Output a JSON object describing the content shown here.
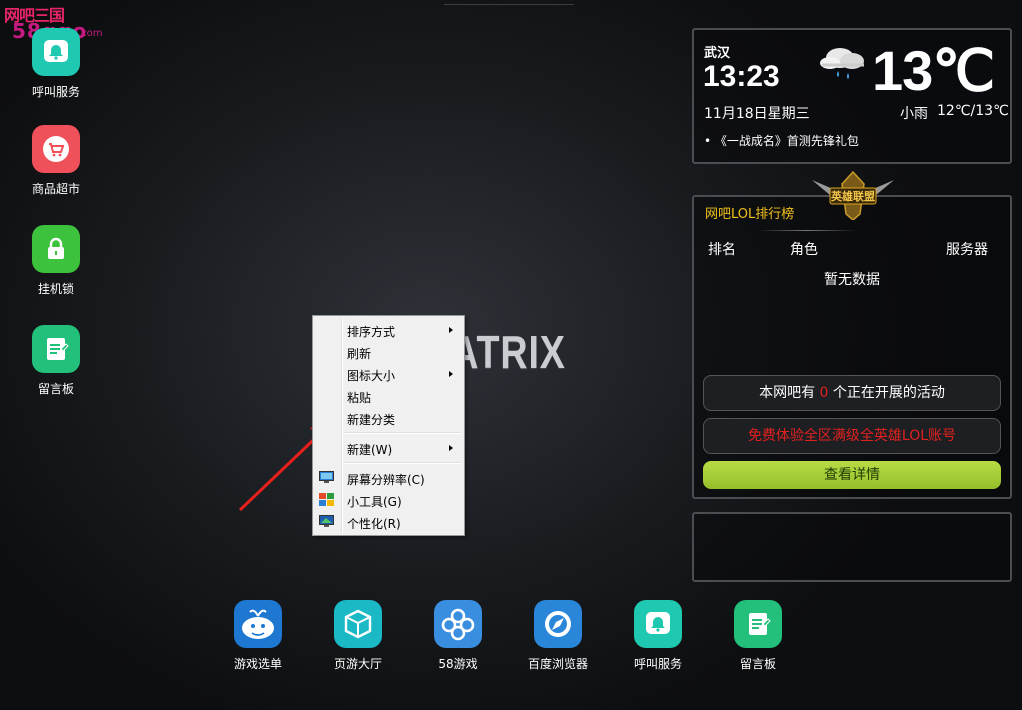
{
  "watermark": {
    "line1": "网吧三国",
    "line2": "58ggo",
    "line3": ".com"
  },
  "desktop_icons": [
    {
      "label": "呼叫服务",
      "icon": "bell-icon",
      "color": "#1fc8b0"
    },
    {
      "label": "商品超市",
      "icon": "shopping-cart-icon",
      "color": "#f0505a"
    },
    {
      "label": "挂机锁",
      "icon": "lock-icon",
      "color": "#3cc23c"
    },
    {
      "label": "留言板",
      "icon": "notepad-icon",
      "color": "#22c07a"
    }
  ],
  "center_logo": "IATRIX",
  "context_menu": {
    "items": [
      {
        "label": "排序方式",
        "submenu": true
      },
      {
        "label": "刷新",
        "submenu": false
      },
      {
        "label": "图标大小",
        "submenu": true
      },
      {
        "label": "粘贴",
        "submenu": false
      },
      {
        "label": "新建分类",
        "submenu": false
      },
      {
        "label": "新建(W)",
        "submenu": true
      },
      {
        "label": "屏幕分辨率(C)",
        "submenu": false,
        "icon": "monitor-icon"
      },
      {
        "label": "小工具(G)",
        "submenu": false,
        "icon": "gadgets-icon"
      },
      {
        "label": "个性化(R)",
        "submenu": false,
        "icon": "personalize-icon"
      }
    ]
  },
  "annotation": {
    "color": "#e8201c"
  },
  "weather": {
    "city": "武汉",
    "time": "13:23",
    "date": "11月18日星期三",
    "temperature": "13℃",
    "condition": "小雨",
    "range": "12℃/13℃",
    "news": "《一战成名》首测先锋礼包"
  },
  "lol_panel": {
    "title": "网吧LOL排行榜",
    "emblem_text": "英雄联盟",
    "columns": [
      "排名",
      "角色",
      "服务器"
    ],
    "empty_text": "暂无数据",
    "activity_prefix": "本网吧有",
    "activity_count": "0",
    "activity_suffix": "个正在开展的活动",
    "promo_text": "免费体验全区满级全英雄LOL账号",
    "details_button": "查看详情",
    "accent": "#f3c21c",
    "button_color": "#a6cf36"
  },
  "dock": [
    {
      "label": "游戏选单",
      "icon": "whale-icon",
      "color": "#1e78d2"
    },
    {
      "label": "页游大厅",
      "icon": "cube-icon",
      "color": "#1bb8c6"
    },
    {
      "label": "58游戏",
      "icon": "gamepad-icon",
      "color": "#3a8ee0"
    },
    {
      "label": "百度浏览器",
      "icon": "compass-icon",
      "color": "#2a86d8"
    },
    {
      "label": "呼叫服务",
      "icon": "bell-icon",
      "color": "#1fc8b0"
    },
    {
      "label": "留言板",
      "icon": "notepad-icon",
      "color": "#22c07a"
    }
  ]
}
